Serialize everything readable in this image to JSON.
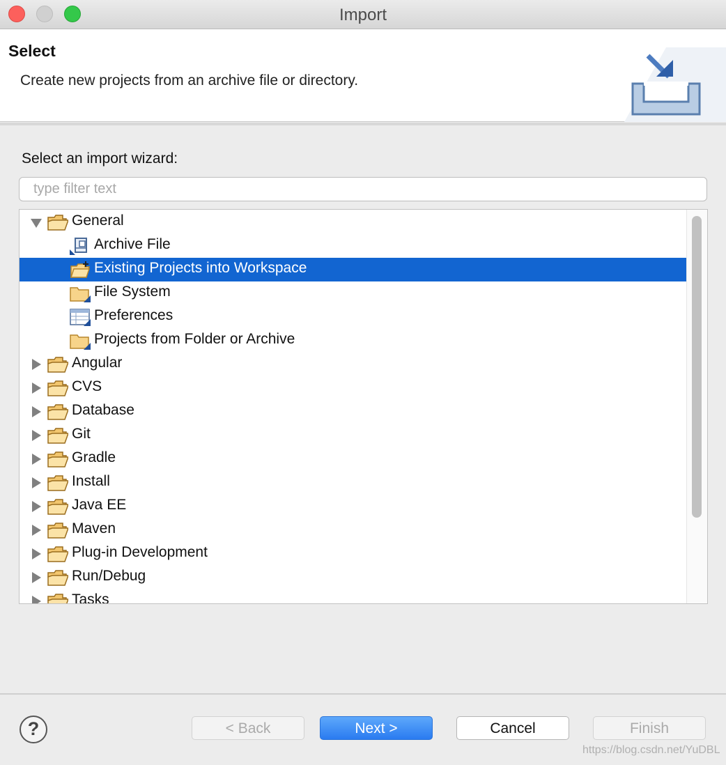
{
  "window": {
    "title": "Import"
  },
  "header": {
    "title": "Select",
    "description": "Create new projects from an archive file or directory."
  },
  "wizard": {
    "label": "Select an import wizard:",
    "filter_placeholder": "type filter text",
    "tree": [
      {
        "label": "General",
        "icon": "folder-open-icon",
        "expanded": true
      },
      {
        "label": "Archive File",
        "icon": "archive-file-icon"
      },
      {
        "label": "Existing Projects into Workspace",
        "icon": "existing-projects-icon",
        "selected": true
      },
      {
        "label": "File System",
        "icon": "folder-icon"
      },
      {
        "label": "Preferences",
        "icon": "preferences-icon"
      },
      {
        "label": "Projects from Folder or Archive",
        "icon": "folder-icon"
      },
      {
        "label": "Angular",
        "icon": "folder-open-icon",
        "expanded": false
      },
      {
        "label": "CVS",
        "icon": "folder-open-icon",
        "expanded": false
      },
      {
        "label": "Database",
        "icon": "folder-open-icon",
        "expanded": false
      },
      {
        "label": "Git",
        "icon": "folder-open-icon",
        "expanded": false
      },
      {
        "label": "Gradle",
        "icon": "folder-open-icon",
        "expanded": false
      },
      {
        "label": "Install",
        "icon": "folder-open-icon",
        "expanded": false
      },
      {
        "label": "Java EE",
        "icon": "folder-open-icon",
        "expanded": false
      },
      {
        "label": "Maven",
        "icon": "folder-open-icon",
        "expanded": false
      },
      {
        "label": "Plug-in Development",
        "icon": "folder-open-icon",
        "expanded": false
      },
      {
        "label": "Run/Debug",
        "icon": "folder-open-icon",
        "expanded": false
      },
      {
        "label": "Tasks",
        "icon": "folder-open-icon",
        "expanded": false
      }
    ]
  },
  "buttons": {
    "help": "?",
    "back": "< Back",
    "next": "Next >",
    "cancel": "Cancel",
    "finish": "Finish"
  },
  "watermark": "https://blog.csdn.net/YuDBL",
  "colors": {
    "selection": "#1265d1",
    "primary_button": "#2a7bf0"
  }
}
